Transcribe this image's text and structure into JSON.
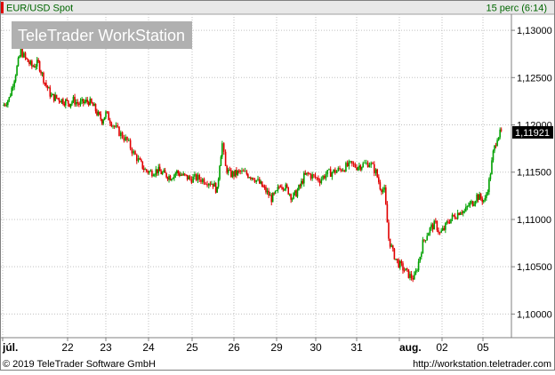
{
  "header": {
    "symbol": "EUR/USD Spot",
    "interval": "15 perc (6:14)"
  },
  "watermark": "TeleTrader WorkStation",
  "footer": {
    "copyright": "© 2019 TeleTrader Software GmbH",
    "url": "http://workstation.teletrader.com"
  },
  "colors": {
    "up": "#00a000",
    "down": "#e00000",
    "grid": "#c0c0c0",
    "header_bg": "#e8e8e8",
    "header_text": "#006600",
    "watermark_bg": "#b0b0b0"
  },
  "chart_data": {
    "type": "candlestick",
    "title": "EUR/USD Spot",
    "x_ticks": [
      "júl.",
      "22",
      "23",
      "24",
      "25",
      "26",
      "29",
      "30",
      "31",
      "aug.",
      "02",
      "05"
    ],
    "y_ticks": [
      "1,13000",
      "1,12500",
      "1,12000",
      "1,11500",
      "1,11000",
      "1,10500",
      "1,10000"
    ],
    "y_tick_values": [
      1.13,
      1.125,
      1.12,
      1.115,
      1.11,
      1.105,
      1.1
    ],
    "ylim": [
      1.0975,
      1.1317
    ],
    "last_value": 1.11921,
    "last_label": "1,11921",
    "grid": true,
    "series": [
      {
        "values": [
          [
            0.0,
            1.122
          ],
          [
            0.1,
            1.1228
          ],
          [
            0.2,
            1.1255
          ],
          [
            0.28,
            1.1278
          ],
          [
            0.35,
            1.127
          ],
          [
            0.45,
            1.1262
          ],
          [
            0.55,
            1.1265
          ],
          [
            0.65,
            1.1245
          ],
          [
            0.75,
            1.123
          ],
          [
            0.85,
            1.1228
          ],
          [
            0.95,
            1.1225
          ],
          [
            1.05,
            1.1223
          ],
          [
            1.15,
            1.1226
          ],
          [
            1.3,
            1.1222
          ],
          [
            1.45,
            1.1224
          ],
          [
            1.55,
            1.1225
          ],
          [
            1.7,
            1.1218
          ],
          [
            1.8,
            1.121
          ],
          [
            1.9,
            1.1205
          ],
          [
            2.0,
            1.1212
          ],
          [
            2.1,
            1.1205
          ],
          [
            2.2,
            1.1198
          ],
          [
            2.35,
            1.119
          ],
          [
            2.5,
            1.1183
          ],
          [
            2.65,
            1.117
          ],
          [
            2.8,
            1.116
          ],
          [
            2.92,
            1.1152
          ],
          [
            3.05,
            1.115
          ],
          [
            3.2,
            1.1152
          ],
          [
            3.35,
            1.1148
          ],
          [
            3.5,
            1.1145
          ],
          [
            3.65,
            1.115
          ],
          [
            3.8,
            1.1146
          ],
          [
            3.95,
            1.1143
          ],
          [
            4.1,
            1.1144
          ],
          [
            4.25,
            1.1142
          ],
          [
            4.4,
            1.114
          ],
          [
            4.5,
            1.1138
          ],
          [
            4.6,
            1.113
          ],
          [
            4.66,
            1.116
          ],
          [
            4.72,
            1.118
          ],
          [
            4.8,
            1.1155
          ],
          [
            4.9,
            1.1148
          ],
          [
            5.0,
            1.1148
          ],
          [
            5.15,
            1.115
          ],
          [
            5.3,
            1.1148
          ],
          [
            5.45,
            1.1145
          ],
          [
            5.6,
            1.1138
          ],
          [
            5.75,
            1.113
          ],
          [
            5.88,
            1.1122
          ],
          [
            6.0,
            1.1128
          ],
          [
            6.1,
            1.1138
          ],
          [
            6.2,
            1.1135
          ],
          [
            6.3,
            1.113
          ],
          [
            6.4,
            1.1123
          ],
          [
            6.5,
            1.1128
          ],
          [
            6.6,
            1.1135
          ],
          [
            6.7,
            1.1145
          ],
          [
            6.8,
            1.1148
          ],
          [
            6.95,
            1.1145
          ],
          [
            7.1,
            1.1142
          ],
          [
            7.25,
            1.1148
          ],
          [
            7.4,
            1.115
          ],
          [
            7.55,
            1.1152
          ],
          [
            7.7,
            1.1155
          ],
          [
            7.85,
            1.1158
          ],
          [
            8.0,
            1.1156
          ],
          [
            8.15,
            1.1158
          ],
          [
            8.3,
            1.116
          ],
          [
            8.45,
            1.115
          ],
          [
            8.55,
            1.1135
          ],
          [
            8.65,
            1.113
          ],
          [
            8.75,
            1.108
          ],
          [
            8.85,
            1.1065
          ],
          [
            8.95,
            1.1055
          ],
          [
            9.05,
            1.105
          ],
          [
            9.15,
            1.1045
          ],
          [
            9.25,
            1.104
          ],
          [
            9.35,
            1.1038
          ],
          [
            9.45,
            1.1055
          ],
          [
            9.55,
            1.1075
          ],
          [
            9.65,
            1.1085
          ],
          [
            9.75,
            1.1092
          ],
          [
            9.85,
            1.1095
          ],
          [
            9.95,
            1.1085
          ],
          [
            10.05,
            1.109
          ],
          [
            10.15,
            1.1098
          ],
          [
            10.25,
            1.1102
          ],
          [
            10.35,
            1.1105
          ],
          [
            10.45,
            1.111
          ],
          [
            10.55,
            1.1108
          ],
          [
            10.65,
            1.1115
          ],
          [
            10.75,
            1.1118
          ],
          [
            10.85,
            1.1125
          ],
          [
            10.95,
            1.1122
          ],
          [
            11.05,
            1.112
          ],
          [
            11.15,
            1.114
          ],
          [
            11.25,
            1.117
          ],
          [
            11.35,
            1.1188
          ],
          [
            11.45,
            1.1192
          ]
        ]
      }
    ]
  }
}
